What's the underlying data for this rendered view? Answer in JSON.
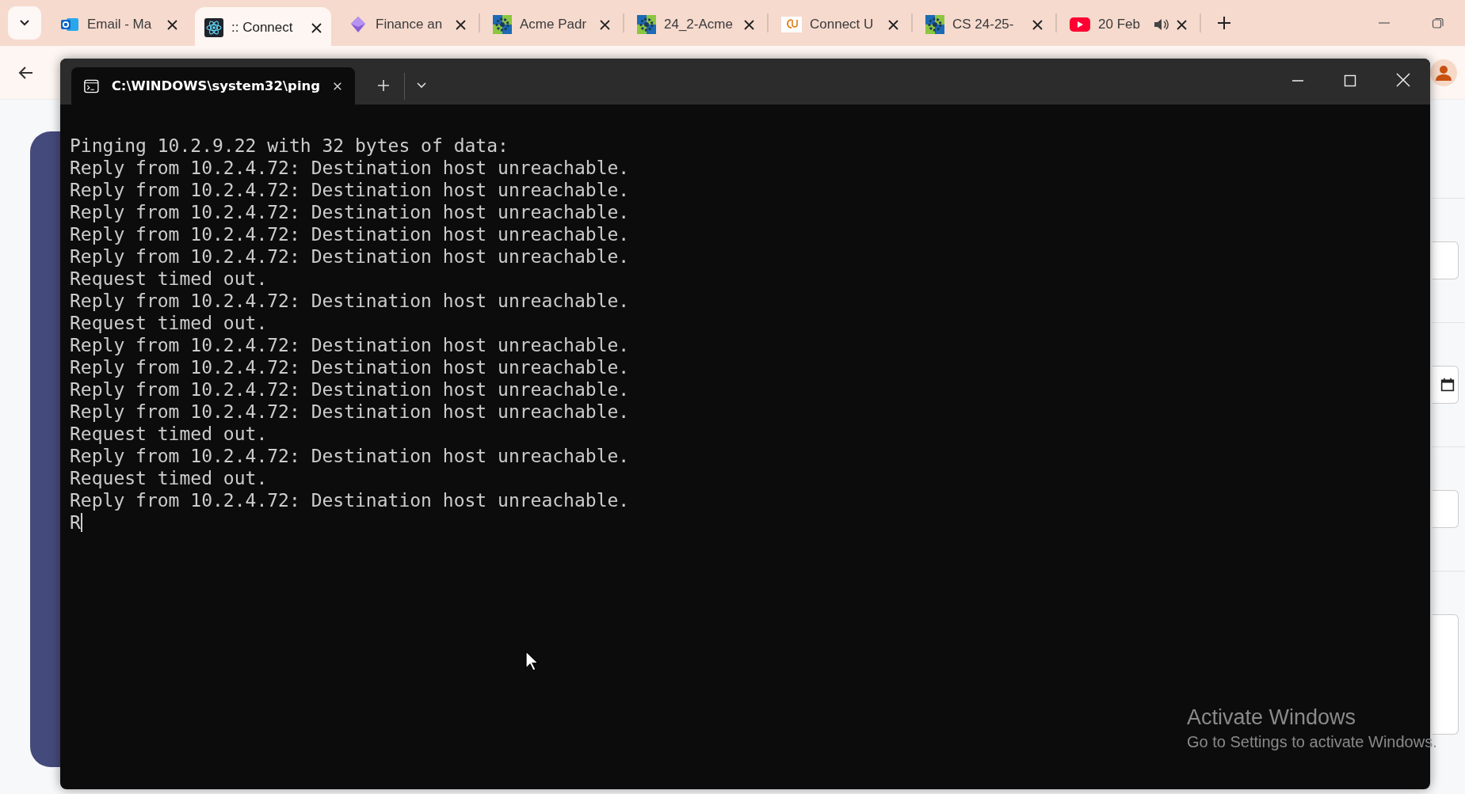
{
  "browser": {
    "tabs": [
      {
        "label": "Email - Ma",
        "kind": "mail",
        "selected": false,
        "audio": false
      },
      {
        "label": ":: Connect",
        "kind": "atom",
        "selected": true,
        "audio": false
      },
      {
        "label": "Finance an",
        "kind": "diamond",
        "selected": false,
        "audio": false
      },
      {
        "label": "Acme Padr",
        "kind": "gear",
        "selected": false,
        "audio": false
      },
      {
        "label": "24_2-Acme",
        "kind": "gear",
        "selected": false,
        "audio": false
      },
      {
        "label": "Connect U",
        "kind": "cu",
        "selected": false,
        "audio": false
      },
      {
        "label": "CS 24-25-",
        "kind": "gear",
        "selected": false,
        "audio": false
      },
      {
        "label": "20 Feb",
        "kind": "play",
        "selected": false,
        "audio": true
      }
    ]
  },
  "terminal": {
    "tab_title": "C:\\WINDOWS\\system32\\ping",
    "lines": [
      "Pinging 10.2.9.22 with 32 bytes of data:",
      "Reply from 10.2.4.72: Destination host unreachable.",
      "Reply from 10.2.4.72: Destination host unreachable.",
      "Reply from 10.2.4.72: Destination host unreachable.",
      "Reply from 10.2.4.72: Destination host unreachable.",
      "Reply from 10.2.4.72: Destination host unreachable.",
      "Request timed out.",
      "Reply from 10.2.4.72: Destination host unreachable.",
      "Request timed out.",
      "Reply from 10.2.4.72: Destination host unreachable.",
      "Reply from 10.2.4.72: Destination host unreachable.",
      "Reply from 10.2.4.72: Destination host unreachable.",
      "Reply from 10.2.4.72: Destination host unreachable.",
      "Request timed out.",
      "Reply from 10.2.4.72: Destination host unreachable.",
      "Request timed out.",
      "Reply from 10.2.4.72: Destination host unreachable."
    ],
    "current_line": "R"
  },
  "activation_notice": {
    "title": "Activate Windows",
    "message": "Go to Settings to activate Windows."
  }
}
